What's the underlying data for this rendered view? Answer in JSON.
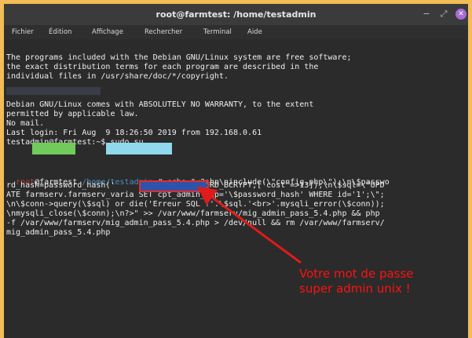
{
  "window": {
    "title": "root@farmtest: /home/testadmin",
    "menu": [
      "Fichier",
      "Édition",
      "Affichage",
      "Rechercher",
      "Terminal",
      "Aide"
    ]
  },
  "terminal": {
    "lines": [
      "The programs included with the Debian GNU/Linux system are free software;",
      "the exact distribution terms for each program are described in the",
      "individual files in /usr/share/doc/*/copyright.",
      "Debian GNU/Linux comes with ABSOLUTELY NO WARRANTY, to the extent",
      "permitted by applicable law.",
      "No mail.",
      "Last login: Fri Aug  9 18:26:50 2019 from 192.168.0.61",
      "testadmin@farmtest:~$ sudo su",
      "rd_hash=password_hash('            ',PASSWORD_BCRYPT,['cost'=>13]);\\n\\$sql=\\\"UPD",
      "ATE farmserv.farmserv_varia SET cpt_admin_mdp='\\$password_hash' WHERE id='1';\\\";",
      "\\n\\$conn->query(\\$sql) or die('Erreur SQL !'.\\$sql.'<br>'.mysqli_error(\\$conn));",
      "\\nmysqli_close(\\$conn);\\n?>\" >> /var/www/farmserv/mig_admin_pass_5.4.php && php",
      "-f /var/www/farmserv/mig_admin_pass_5.4.php > /dev/null && rm /var/www/farmserv/",
      "mig_admin_pass_5.4.php"
    ],
    "faded_line": "Votre mot de passe",
    "root_line": {
      "user": "root",
      "host": "farmtest",
      "path": "/home/testadmin",
      "command": "# echo \"<?php\\ninclude(\\\"config.php\\\");\\n\\$passwo"
    }
  },
  "annotation": {
    "line1": "Votre mot de passe",
    "line2": "super admin unix !"
  }
}
